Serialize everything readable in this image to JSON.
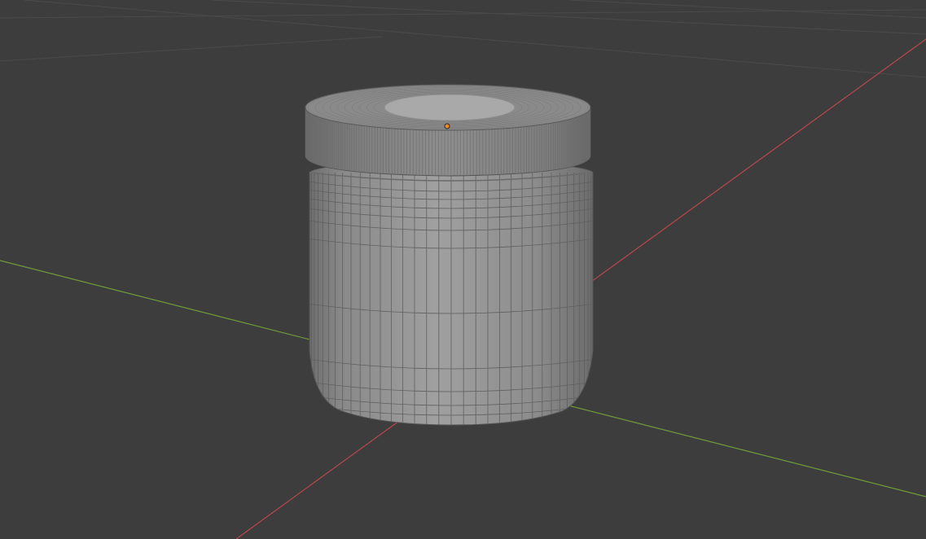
{
  "viewport": {
    "mode": "3d-viewport",
    "shading": "solid",
    "overlay": "wireframe",
    "object": "jar-with-screw-cap"
  },
  "colors": {
    "background": "#3d3d3d",
    "grid_line": "#4a4a4a",
    "x_axis": "#b9474c",
    "y_axis": "#6e9c3a",
    "mesh_fill": "#8f8f8f",
    "mesh_fill_light": "#a3a3a3",
    "mesh_fill_dark": "#7a7a7a",
    "wire": "#5a5a5a",
    "origin": "#f08a24"
  }
}
